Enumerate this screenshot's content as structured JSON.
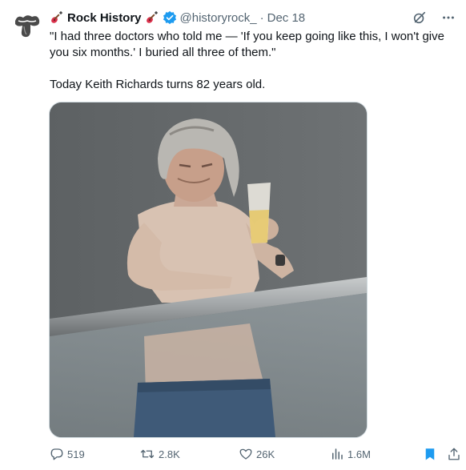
{
  "tweet": {
    "author_name": "Rock History",
    "handle": "@historyrock_",
    "separator": "·",
    "date": "Dec 18",
    "text_line1": "\"I had three doctors who told me — 'If you keep going like this, I won't give you six months.' I buried all three of them.\"",
    "text_line2": "Today Keith Richards turns 82 years old.",
    "media_description": "Photo of Keith Richards shirtless holding a beer glass while leaning on a balcony railing"
  },
  "actions": {
    "replies": "519",
    "reposts": "2.8K",
    "likes": "26K",
    "views": "1.6M"
  },
  "colors": {
    "text": "#0f1419",
    "secondary": "#536471",
    "verified": "#1d9bf0",
    "bookmark_active": "#1d9bf0",
    "guitar": "#d9304a"
  },
  "icons": {
    "avatar": "rolling-stones-tongue-logo",
    "emoji": "guitar-icon",
    "verified": "verified-badge-icon",
    "grok": "grok-icon",
    "more": "more-icon",
    "reply": "reply-icon",
    "repost": "repost-icon",
    "like": "like-icon",
    "views": "views-icon",
    "bookmark": "bookmark-icon",
    "share": "share-icon"
  }
}
